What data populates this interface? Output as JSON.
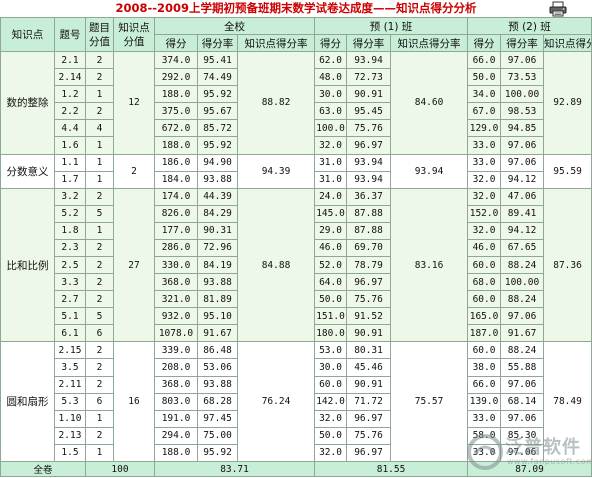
{
  "title": "2008--2009上学期初预备班期末数学试卷达成度——知识点得分分析",
  "icons": {
    "print": "printer-icon"
  },
  "colors": {
    "title": "#cc0000",
    "header_bg": "#c9eed8",
    "group_bg_odd": "#eef8e8",
    "border": "#8fa896"
  },
  "headers": {
    "topic": "知识点",
    "qno": "题号",
    "q_score_line1": "题目",
    "q_score_line2": "分值",
    "topic_score_line1": "知识点",
    "topic_score_line2": "分值",
    "school": "全校",
    "class1": "预 (1) 班",
    "class2": "预 (2) 班",
    "score": "得分",
    "rate": "得分率",
    "topic_rate": "知识点得分率"
  },
  "groups": [
    {
      "topic": "数的整除",
      "topic_score": "12",
      "school_topic_rate": "88.82",
      "c1_topic_rate": "84.60",
      "c2_topic_rate": "92.89",
      "rows": [
        {
          "q": "2.1",
          "v": "2",
          "s": "374.0",
          "sr": "95.41",
          "c1": "62.0",
          "c1r": "93.94",
          "c2": "66.0",
          "c2r": "97.06"
        },
        {
          "q": "2.14",
          "v": "2",
          "s": "292.0",
          "sr": "74.49",
          "c1": "48.0",
          "c1r": "72.73",
          "c2": "50.0",
          "c2r": "73.53"
        },
        {
          "q": "1.2",
          "v": "1",
          "s": "188.0",
          "sr": "95.92",
          "c1": "30.0",
          "c1r": "90.91",
          "c2": "34.0",
          "c2r": "100.00"
        },
        {
          "q": "2.2",
          "v": "2",
          "s": "375.0",
          "sr": "95.67",
          "c1": "63.0",
          "c1r": "95.45",
          "c2": "67.0",
          "c2r": "98.53"
        },
        {
          "q": "4.4",
          "v": "4",
          "s": "672.0",
          "sr": "85.72",
          "c1": "100.0",
          "c1r": "75.76",
          "c2": "129.0",
          "c2r": "94.85"
        },
        {
          "q": "1.6",
          "v": "1",
          "s": "188.0",
          "sr": "95.92",
          "c1": "32.0",
          "c1r": "96.97",
          "c2": "33.0",
          "c2r": "97.06"
        }
      ]
    },
    {
      "topic": "分数意义",
      "topic_score": "2",
      "school_topic_rate": "94.39",
      "c1_topic_rate": "93.94",
      "c2_topic_rate": "95.59",
      "rows": [
        {
          "q": "1.1",
          "v": "1",
          "s": "186.0",
          "sr": "94.90",
          "c1": "31.0",
          "c1r": "93.94",
          "c2": "33.0",
          "c2r": "97.06"
        },
        {
          "q": "1.7",
          "v": "1",
          "s": "184.0",
          "sr": "93.88",
          "c1": "31.0",
          "c1r": "93.94",
          "c2": "32.0",
          "c2r": "94.12"
        }
      ]
    },
    {
      "topic": "比和比例",
      "topic_score": "27",
      "school_topic_rate": "84.88",
      "c1_topic_rate": "83.16",
      "c2_topic_rate": "87.36",
      "rows": [
        {
          "q": "3.2",
          "v": "2",
          "s": "174.0",
          "sr": "44.39",
          "c1": "24.0",
          "c1r": "36.37",
          "c2": "32.0",
          "c2r": "47.06"
        },
        {
          "q": "5.2",
          "v": "5",
          "s": "826.0",
          "sr": "84.29",
          "c1": "145.0",
          "c1r": "87.88",
          "c2": "152.0",
          "c2r": "89.41"
        },
        {
          "q": "1.8",
          "v": "1",
          "s": "177.0",
          "sr": "90.31",
          "c1": "29.0",
          "c1r": "87.88",
          "c2": "32.0",
          "c2r": "94.12"
        },
        {
          "q": "2.3",
          "v": "2",
          "s": "286.0",
          "sr": "72.96",
          "c1": "46.0",
          "c1r": "69.70",
          "c2": "46.0",
          "c2r": "67.65"
        },
        {
          "q": "2.5",
          "v": "2",
          "s": "330.0",
          "sr": "84.19",
          "c1": "52.0",
          "c1r": "78.79",
          "c2": "60.0",
          "c2r": "88.24"
        },
        {
          "q": "3.3",
          "v": "2",
          "s": "368.0",
          "sr": "93.88",
          "c1": "64.0",
          "c1r": "96.97",
          "c2": "68.0",
          "c2r": "100.00"
        },
        {
          "q": "2.7",
          "v": "2",
          "s": "321.0",
          "sr": "81.89",
          "c1": "50.0",
          "c1r": "75.76",
          "c2": "60.0",
          "c2r": "88.24"
        },
        {
          "q": "5.1",
          "v": "5",
          "s": "932.0",
          "sr": "95.10",
          "c1": "151.0",
          "c1r": "91.52",
          "c2": "165.0",
          "c2r": "97.06"
        },
        {
          "q": "6.1",
          "v": "6",
          "s": "1078.0",
          "sr": "91.67",
          "c1": "180.0",
          "c1r": "90.91",
          "c2": "187.0",
          "c2r": "91.67"
        }
      ]
    },
    {
      "topic": "圆和扇形",
      "topic_score": "16",
      "school_topic_rate": "76.24",
      "c1_topic_rate": "75.57",
      "c2_topic_rate": "78.49",
      "rows": [
        {
          "q": "2.15",
          "v": "2",
          "s": "339.0",
          "sr": "86.48",
          "c1": "53.0",
          "c1r": "80.31",
          "c2": "60.0",
          "c2r": "88.24"
        },
        {
          "q": "3.5",
          "v": "2",
          "s": "208.0",
          "sr": "53.06",
          "c1": "30.0",
          "c1r": "45.46",
          "c2": "38.0",
          "c2r": "55.88"
        },
        {
          "q": "2.11",
          "v": "2",
          "s": "368.0",
          "sr": "93.88",
          "c1": "60.0",
          "c1r": "90.91",
          "c2": "66.0",
          "c2r": "97.06"
        },
        {
          "q": "5.3",
          "v": "6",
          "s": "803.0",
          "sr": "68.28",
          "c1": "142.0",
          "c1r": "71.72",
          "c2": "139.0",
          "c2r": "68.14"
        },
        {
          "q": "1.10",
          "v": "1",
          "s": "191.0",
          "sr": "97.45",
          "c1": "32.0",
          "c1r": "96.97",
          "c2": "33.0",
          "c2r": "97.06"
        },
        {
          "q": "2.13",
          "v": "2",
          "s": "294.0",
          "sr": "75.00",
          "c1": "50.0",
          "c1r": "75.76",
          "c2": "58.0",
          "c2r": "85.30"
        },
        {
          "q": "1.5",
          "v": "1",
          "s": "188.0",
          "sr": "95.92",
          "c1": "32.0",
          "c1r": "96.97",
          "c2": "33.0",
          "c2r": "97.06"
        }
      ]
    }
  ],
  "total": {
    "label": "全卷",
    "score": "100",
    "school": "83.71",
    "class1": "81.55",
    "class2": "87.09"
  },
  "watermark": {
    "text": "泛普软件",
    "url": "www.fanpusoft.com"
  }
}
